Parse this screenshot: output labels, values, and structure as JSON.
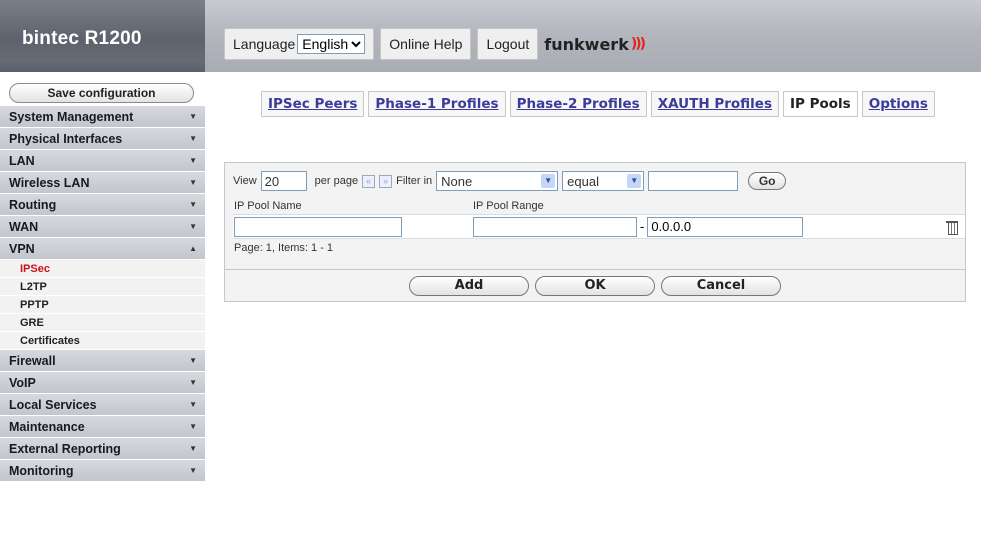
{
  "app": {
    "title": "bintec R1200"
  },
  "header": {
    "language_label": "Language",
    "language_value": "English",
    "online_help": "Online Help",
    "logout": "Logout",
    "logo_text": "funkwerk",
    "logo_mark": ")))"
  },
  "sidebar": {
    "save_label": "Save configuration",
    "items": [
      {
        "label": "System Management",
        "expanded": false
      },
      {
        "label": "Physical Interfaces",
        "expanded": false
      },
      {
        "label": "LAN",
        "expanded": false
      },
      {
        "label": "Wireless LAN",
        "expanded": false
      },
      {
        "label": "Routing",
        "expanded": false
      },
      {
        "label": "WAN",
        "expanded": false
      },
      {
        "label": "VPN",
        "expanded": true
      },
      {
        "label": "Firewall",
        "expanded": false
      },
      {
        "label": "VoIP",
        "expanded": false
      },
      {
        "label": "Local Services",
        "expanded": false
      },
      {
        "label": "Maintenance",
        "expanded": false
      },
      {
        "label": "External Reporting",
        "expanded": false
      },
      {
        "label": "Monitoring",
        "expanded": false
      }
    ],
    "vpn_sub": [
      "IPSec",
      "L2TP",
      "PPTP",
      "GRE",
      "Certificates"
    ],
    "active_sub": "IPSec"
  },
  "tabs": [
    {
      "label": "IPSec Peers",
      "active": false
    },
    {
      "label": "Phase-1 Profiles",
      "active": false
    },
    {
      "label": "Phase-2 Profiles",
      "active": false
    },
    {
      "label": "XAUTH Profiles",
      "active": false
    },
    {
      "label": "IP Pools",
      "active": true
    },
    {
      "label": "Options",
      "active": false
    }
  ],
  "filter": {
    "view_label": "View",
    "view_value": "20",
    "per_page": "per page",
    "prev": "«",
    "next": "»",
    "filter_in": "Filter in",
    "filter_field": "None",
    "operator": "equal",
    "value": "",
    "go": "Go"
  },
  "table": {
    "headers": [
      "IP Pool Name",
      "IP Pool Range"
    ],
    "rows": [
      {
        "name": "",
        "range_start": "",
        "separator": "-",
        "range_end": "0.0.0.0"
      }
    ],
    "footer": "Page: 1, Items: 1 - 1"
  },
  "actions": {
    "add": "Add",
    "ok": "OK",
    "cancel": "Cancel"
  }
}
